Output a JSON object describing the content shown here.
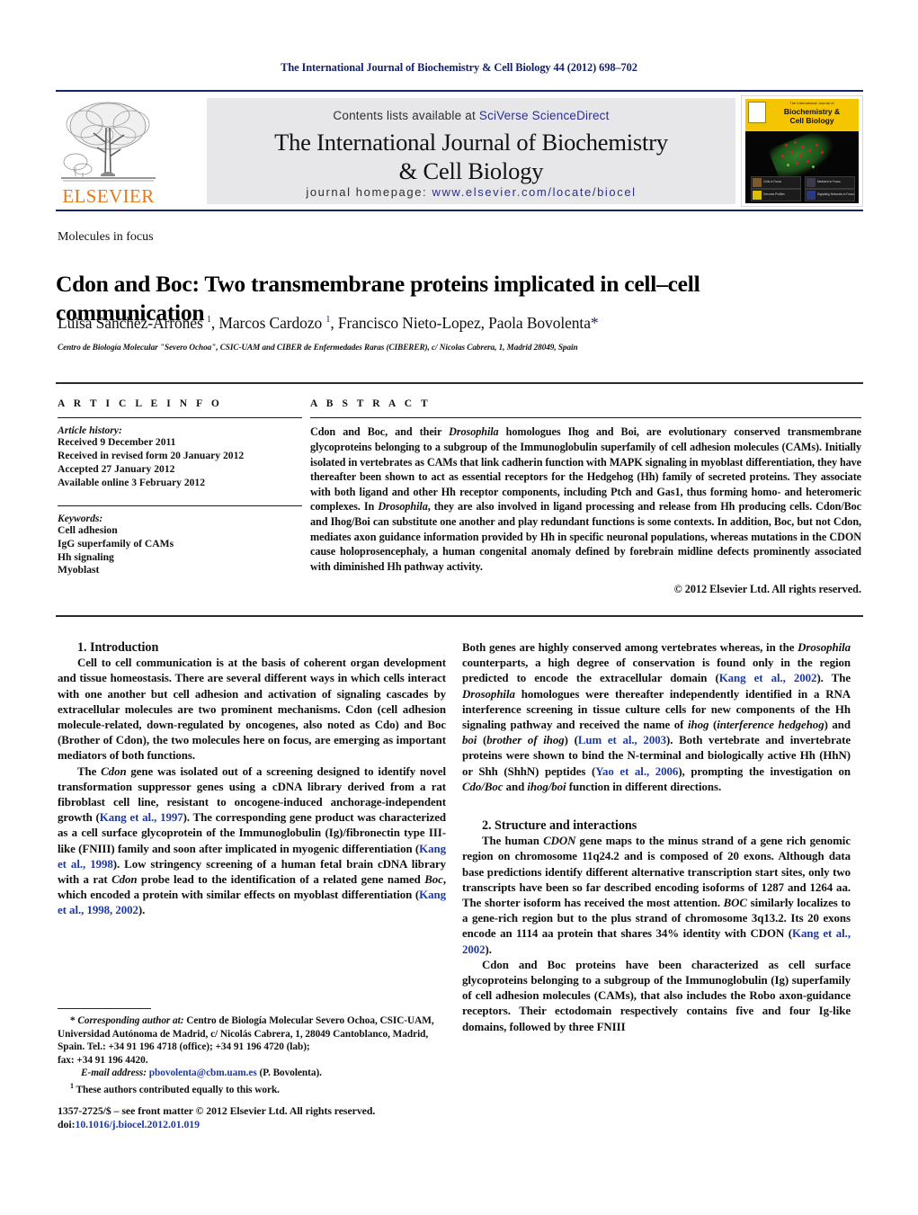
{
  "running_head": "The International Journal of Biochemistry & Cell Biology 44 (2012) 698–702",
  "masthead": {
    "publisher_wordmark": "ELSEVIER",
    "contents_prefix": "Contents lists available at ",
    "contents_link": "SciVerse ScienceDirect",
    "journal_title_line1": "The International Journal of Biochemistry",
    "journal_title_line2": "& Cell Biology",
    "homepage_prefix": "journal homepage: ",
    "homepage_link": "www.elsevier.com/locate/biocel",
    "cover": {
      "small_line": "The International Journal of",
      "name_line1": "Biochemistry &",
      "name_line2": "Cell Biology",
      "mini_labels": [
        "Cells in Focus",
        "Medicine in Focus",
        "Genome Profiles",
        "Signalling Networks in Focus"
      ]
    }
  },
  "article": {
    "type": "Molecules in focus",
    "title": "Cdon and Boc: Two transmembrane proteins implicated in cell–cell communication",
    "authors_html": "Luisa Sanchez-Arrones <sup>1</sup>, Marcos Cardozo <sup>1</sup>, Francisco Nieto-Lopez, Paola Bovolenta<span class=\"star\">*</span>",
    "affiliation": "Centro de Biología Molecular \"Severo Ochoa\", CSIC-UAM and CIBER de Enfermedades Raras (CIBERER), c/ Nicolas Cabrera, 1, Madrid 28049, Spain"
  },
  "article_info": {
    "heading": "A R T I C L E   I N F O",
    "history_label": "Article history:",
    "history": [
      "Received 9 December 2011",
      "Received in revised form 20 January 2012",
      "Accepted 27 January 2012",
      "Available online 3 February 2012"
    ],
    "keywords_label": "Keywords:",
    "keywords": [
      "Cell adhesion",
      "IgG superfamily of CAMs",
      "Hh signaling",
      "Myoblast"
    ]
  },
  "abstract": {
    "heading": "A B S T R A C T",
    "text_html": "Cdon and Boc, and their <i>Drosophila</i> homologues Ihog and Boi, are evolutionary conserved transmembrane glycoproteins belonging to a subgroup of the Immunoglobulin superfamily of cell adhesion molecules (CAMs). Initially isolated in vertebrates as CAMs that link cadherin function with MAPK signaling in myoblast differentiation, they have thereafter been shown to act as essential receptors for the Hedgehog (Hh) family of secreted proteins. They associate with both ligand and other Hh receptor components, including Ptch and Gas1, thus forming homo- and heteromeric complexes. In <i>Drosophila</i>, they are also involved in ligand processing and release from Hh producing cells. Cdon/Boc and Ihog/Boi can substitute one another and play redundant functions is some contexts. In addition, Boc, but not Cdon, mediates axon guidance information provided by Hh in specific neuronal populations, whereas mutations in the CDON cause holoprosencephaly, a human congenital anomaly defined by forebrain midline defects prominently associated with diminished Hh pathway activity.",
    "copyright": "© 2012 Elsevier Ltd. All rights reserved."
  },
  "body": {
    "left_column": {
      "section_1_heading": "1. Introduction",
      "paragraph_1_html": "Cell to cell communication is at the basis of coherent organ development and tissue homeostasis. There are several different ways in which cells interact with one another but cell adhesion and activation of signaling cascades by extracellular molecules are two prominent mechanisms. Cdon (cell adhesion molecule-related, down-regulated by oncogenes, also noted as Cdo) and Boc (Brother of Cdon), the two molecules here on focus, are emerging as important mediators of both functions.",
      "paragraph_2_html": "The <i>Cdon</i> gene was isolated out of a screening designed to identify novel transformation suppressor genes using a cDNA library derived from a rat fibroblast cell line, resistant to oncogene-induced anchorage-independent growth (<span class=\"ref\">Kang et al., 1997</span>). The corresponding gene product was characterized as a cell surface glycoprotein of the Immunoglobulin (Ig)/fibronectin type III-like (FNIII) family and soon after implicated in myogenic differentiation (<span class=\"ref\">Kang et al., 1998</span>). Low stringency screening of a human fetal brain cDNA library with a rat <i>Cdon</i> probe lead to the identification of a related gene named <i>Boc</i>, which encoded a protein with similar effects on myoblast differentiation (<span class=\"ref\">Kang et al., 1998, 2002</span>)."
    },
    "right_column": {
      "paragraph_1_html": "Both genes are highly conserved among vertebrates whereas, in the <i>Drosophila</i> counterparts, a high degree of conservation is found only in the region predicted to encode the extracellular domain (<span class=\"ref\">Kang et al., 2002</span>). The <i>Drosophila</i> homologues were thereafter independently identified in a RNA interference screening in tissue culture cells for new components of the Hh signaling pathway and received the name of <i>ihog</i> (<i>interference hedgehog</i>) and <i>boi</i> (<i>brother of ihog</i>) (<span class=\"ref\">Lum et al., 2003</span>). Both vertebrate and invertebrate proteins were shown to bind the N-terminal and biologically active Hh (HhN) or Shh (ShhN) peptides (<span class=\"ref\">Yao et al., 2006</span>), prompting the investigation on <i>Cdo/Boc</i> and <i>ihog/boi</i> function in different directions.",
      "section_2_heading": "2. Structure and interactions",
      "paragraph_2_html": "The human <i>CDON</i> gene maps to the minus strand of a gene rich genomic region on chromosome 11q24.2 and is composed of 20 exons. Although data base predictions identify different alternative transcription start sites, only two transcripts have been so far described encoding isoforms of 1287 and 1264 aa. The shorter isoform has received the most attention. <i>BOC</i> similarly localizes to a gene-rich region but to the plus strand of chromosome 3q13.2. Its 20 exons encode an 1114 aa protein that shares 34% identity with CDON (<span class=\"ref\">Kang et al., 2002</span>).",
      "paragraph_3_html": "Cdon and Boc proteins have been characterized as cell surface glycoproteins belonging to a subgroup of the Immunoglobulin (Ig) superfamily of cell adhesion molecules (CAMs), that also includes the Robo axon-guidance receptors. Their ectodomain respectively contains five and four Ig-like domains, followed by three FNIII"
    }
  },
  "footnotes": {
    "corresponding_html": "* <i style=\"font-style:italic\">Corresponding author at:</i> Centro de Biología Molecular Severo Ochoa, CSIC-UAM, Universidad Autónoma de Madrid, c/ Nicolás Cabrera, 1, 28049 Cantoblanco, Madrid, Spain. Tel.: +34 91 196 4718 (office); +34 91 196 4720 (lab);",
    "fax_line": "fax: +34 91 196 4420.",
    "email_label": "E-mail address:",
    "email_address": "pbovolenta@cbm.uam.es",
    "email_owner": "(P. Bovolenta).",
    "equal_contribution": "These authors contributed equally to this work.",
    "equal_contribution_marker": "1"
  },
  "issn": {
    "line1": "1357-2725/$ – see front matter © 2012 Elsevier Ltd. All rights reserved.",
    "doi_label": "doi:",
    "doi_value": "10.1016/j.biocel.2012.01.019"
  }
}
